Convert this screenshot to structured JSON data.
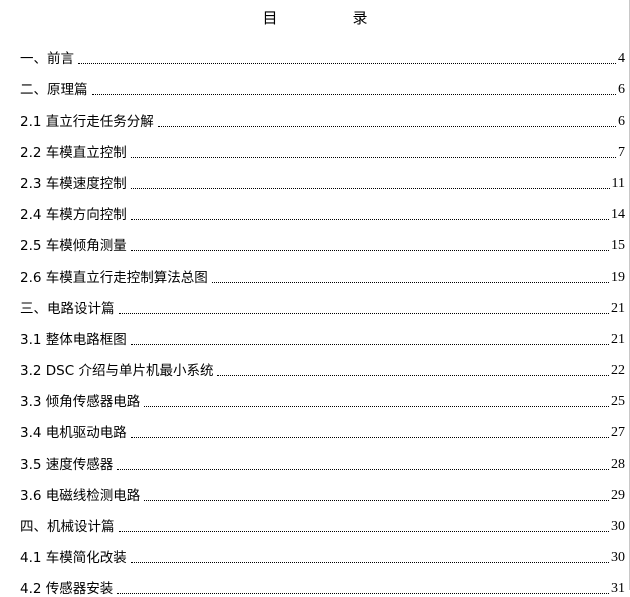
{
  "document": {
    "title": "目　录",
    "entries": [
      {
        "label": "一、前言",
        "page": "4",
        "level": "chapter"
      },
      {
        "label": "二、原理篇",
        "page": "6",
        "level": "chapter"
      },
      {
        "label": "2.1 直立行走任务分解",
        "page": "6",
        "level": "section"
      },
      {
        "label": "2.2 车模直立控制",
        "page": "7",
        "level": "section"
      },
      {
        "label": "2.3 车模速度控制",
        "page": "11",
        "level": "section"
      },
      {
        "label": "2.4 车模方向控制",
        "page": "14",
        "level": "section"
      },
      {
        "label": "2.5 车模倾角测量",
        "page": "15",
        "level": "section"
      },
      {
        "label": "2.6 车模直立行走控制算法总图",
        "page": "19",
        "level": "section"
      },
      {
        "label": "三、电路设计篇",
        "page": "21",
        "level": "chapter"
      },
      {
        "label": "3.1 整体电路框图",
        "page": "21",
        "level": "section"
      },
      {
        "label": "3.2 DSC 介绍与单片机最小系统",
        "page": "22",
        "level": "section"
      },
      {
        "label": "3.3 倾角传感器电路",
        "page": "25",
        "level": "section"
      },
      {
        "label": "3.4 电机驱动电路",
        "page": "27",
        "level": "section"
      },
      {
        "label": "3.5 速度传感器",
        "page": "28",
        "level": "section"
      },
      {
        "label": "3.6 电磁线检测电路",
        "page": "29",
        "level": "section"
      },
      {
        "label": "四、机械设计篇",
        "page": "30",
        "level": "chapter"
      },
      {
        "label": "4.1 车模简化改装",
        "page": "30",
        "level": "section"
      },
      {
        "label": "4.2 传感器安装",
        "page": "31",
        "level": "section"
      }
    ]
  }
}
